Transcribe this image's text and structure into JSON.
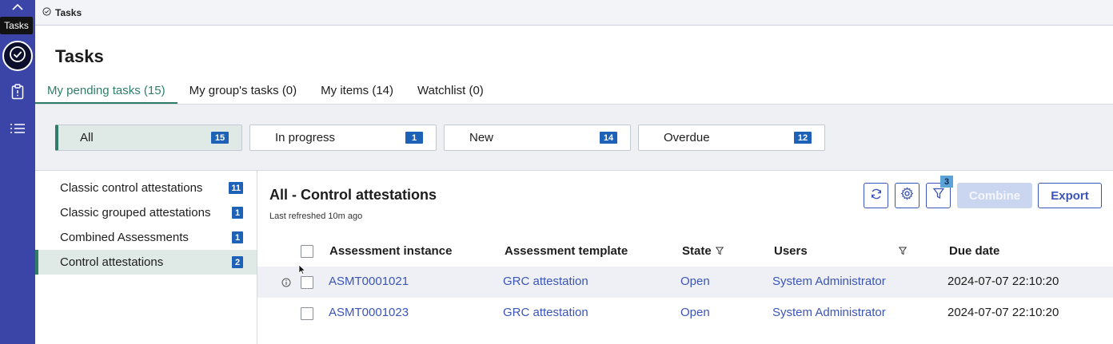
{
  "rail": {
    "tooltip": "Tasks",
    "items": [
      {
        "name": "chevron-up-icon"
      },
      {
        "name": "check-circle-icon"
      },
      {
        "name": "clipboard-icon"
      },
      {
        "name": "list-icon"
      }
    ]
  },
  "topbar": {
    "title": "Tasks"
  },
  "page": {
    "title": "Tasks"
  },
  "tabs": [
    {
      "label": "My pending tasks (15)",
      "active": true
    },
    {
      "label": "My group's tasks (0)"
    },
    {
      "label": "My items (14)"
    },
    {
      "label": "Watchlist (0)"
    }
  ],
  "filters": [
    {
      "label": "All",
      "count": "15",
      "active": true
    },
    {
      "label": "In progress",
      "count": "1"
    },
    {
      "label": "New",
      "count": "14"
    },
    {
      "label": "Overdue",
      "count": "12"
    }
  ],
  "categories": [
    {
      "label": "Classic control attestations",
      "count": "11"
    },
    {
      "label": "Classic grouped attestations",
      "count": "1"
    },
    {
      "label": "Combined Assessments",
      "count": "1"
    },
    {
      "label": "Control attestations",
      "count": "2",
      "active": true
    }
  ],
  "main": {
    "title": "All - Control attestations",
    "refreshed": "Last refreshed 10m ago",
    "filter_count": "3",
    "combine_label": "Combine",
    "export_label": "Export"
  },
  "table": {
    "headers": {
      "instance": "Assessment instance",
      "template": "Assessment template",
      "state": "State",
      "users": "Users",
      "due": "Due date"
    },
    "rows": [
      {
        "instance": "ASMT0001021",
        "template": "GRC attestation",
        "state": "Open",
        "users": "System Administrator",
        "due": "2024-07-07 22:10:20"
      },
      {
        "instance": "ASMT0001023",
        "template": "GRC attestation",
        "state": "Open",
        "users": "System Administrator",
        "due": "2024-07-07 22:10:20"
      }
    ]
  },
  "colors": {
    "rail": "#3b45a8",
    "accent_green": "#2f7d68",
    "link_blue": "#3b55b8",
    "badge_blue": "#1e62b8"
  }
}
